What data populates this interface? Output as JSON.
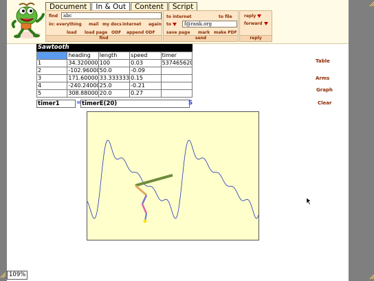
{
  "tabs": [
    {
      "label": "Document",
      "active": false
    },
    {
      "label": "In & Out",
      "active": true
    },
    {
      "label": "Content",
      "active": false
    },
    {
      "label": "Script",
      "active": false
    }
  ],
  "find": {
    "label": "find",
    "value": "abc",
    "in_label": "in:",
    "scopes": [
      "everything",
      "mail",
      "my docs",
      "internet",
      "again"
    ],
    "actions": [
      "load",
      "load page",
      "ODF",
      "append ODF"
    ],
    "bar": "find"
  },
  "send": {
    "to_internet": "to internet",
    "to_file": "to file",
    "to_label": "to",
    "to_value": "f@rank.org",
    "actions": [
      "save page",
      "mark",
      "make PDF"
    ],
    "bar": "send"
  },
  "reply": {
    "reply_label": "reply",
    "forward_label": "forward",
    "bar": "reply"
  },
  "sheet": {
    "title": "Sawtooth",
    "headers": [
      "",
      "heading",
      "length",
      "speed",
      "timer"
    ],
    "rows": [
      [
        "1",
        "34.320000",
        "100",
        "0.03",
        "537465620"
      ],
      [
        "2",
        "-102.96000",
        "50.0",
        "-0.09",
        ""
      ],
      [
        "3",
        "171.60000",
        "33.333333",
        "0.15",
        ""
      ],
      [
        "4",
        "-240.24000",
        "25.0",
        "-0.21",
        ""
      ],
      [
        "5",
        "308.88000",
        "20.0",
        "0.27",
        ""
      ]
    ]
  },
  "formula": {
    "name": "timer1",
    "eq": "=",
    "value": "timerE(20)",
    "s": "S"
  },
  "side_buttons": [
    "Table",
    "Arms",
    "Graph",
    "Clear"
  ],
  "zoom": "109%",
  "colors": {
    "accent": "#8a2a00",
    "panel": "#fde7c8",
    "graph_bg": "#ffffcc",
    "curve": "#2233bb"
  }
}
